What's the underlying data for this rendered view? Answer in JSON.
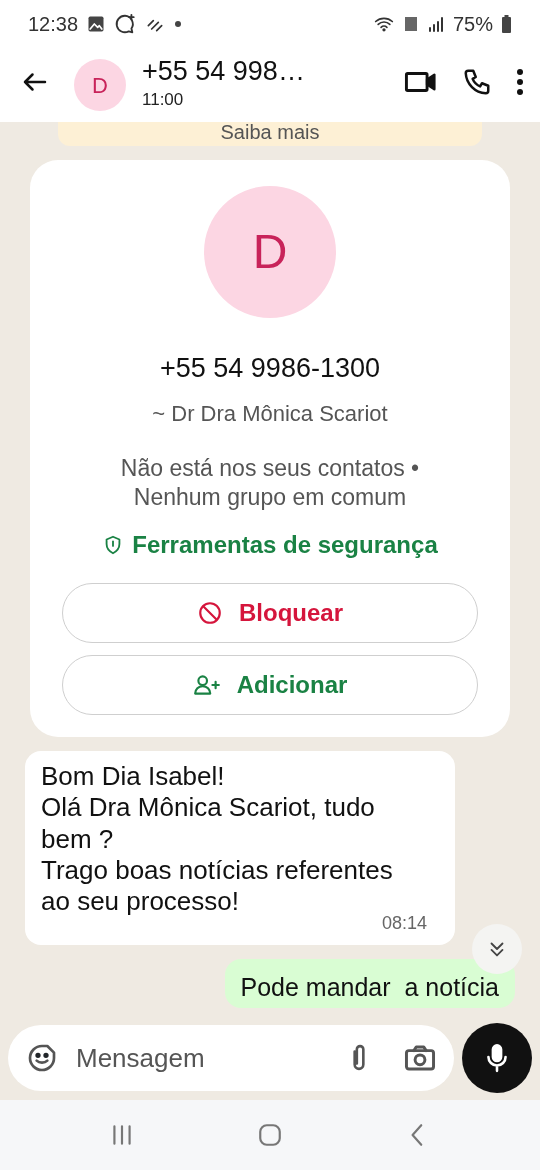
{
  "status_bar": {
    "time": "12:38",
    "battery": "75%"
  },
  "header": {
    "avatar_letter": "D",
    "title": "+55 54 998…",
    "subtitle": "11:00"
  },
  "banner": {
    "text": "Saiba mais"
  },
  "contact_card": {
    "avatar_letter": "D",
    "phone": "+55 54 9986-1300",
    "name": "~ Dr Dra Mônica Scariot",
    "info": [
      "Não está nos seus contatos •",
      "Nenhum grupo em comum"
    ],
    "safety_link": "Ferramentas de segurança",
    "actions": [
      {
        "kind": "block",
        "label": "Bloquear"
      },
      {
        "kind": "add",
        "label": "Adicionar"
      }
    ]
  },
  "messages": [
    {
      "kind": "incoming",
      "paragraphs": [
        "Bom Dia Isabel!",
        "Olá Dra Mônica Scariot, tudo bem ?",
        "Trago boas notícias referentes ao seu processo!"
      ],
      "time": "08:14"
    },
    {
      "kind": "outgoing",
      "paragraphs": [
        "Pode mandar  a notícia"
      ]
    }
  ],
  "composer": {
    "placeholder": "Mensagem"
  }
}
